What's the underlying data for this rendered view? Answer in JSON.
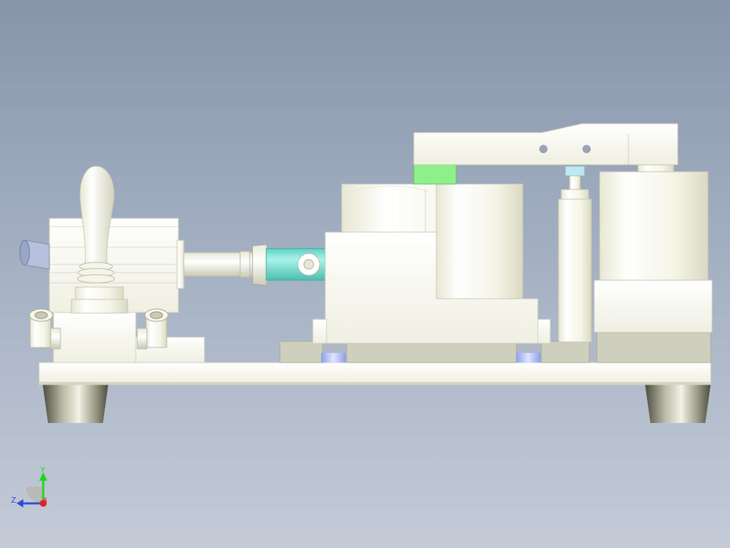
{
  "viewport": {
    "background_top": "#8795ab",
    "background_bottom": "#c4cbd7"
  },
  "model": {
    "body_color": "#ffffff",
    "shadow_color": "#c9c9b5",
    "rod_color": "#7fded2",
    "stopper_color": "#8df08a"
  },
  "triad": {
    "y_label": "Y",
    "z_label": "Z",
    "x_label": "X",
    "y_color": "#1ed61e",
    "z_color": "#2b4fd8",
    "x_color": "#e0202a"
  }
}
